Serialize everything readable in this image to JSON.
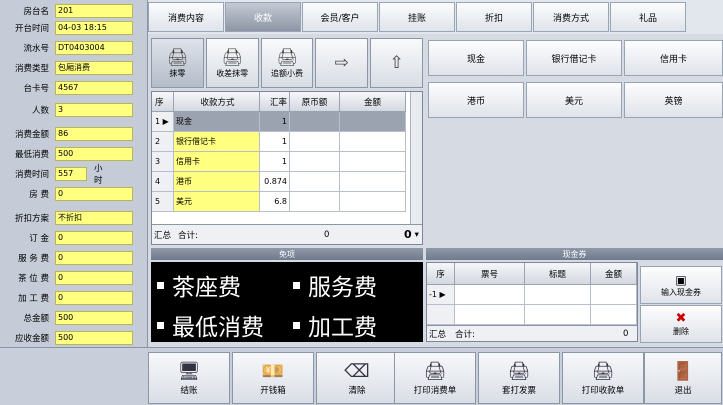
{
  "left_panel": {
    "fields": [
      {
        "label": "房台名",
        "value": "201"
      },
      {
        "label": "开台时间",
        "value": "04-03 18:15"
      },
      {
        "label": "流水号",
        "value": "DT0403004"
      },
      {
        "label": "消费类型",
        "value": "包厢消费"
      },
      {
        "label": "台卡号",
        "value": "4567"
      },
      {
        "label": "人数",
        "value": "3"
      },
      {
        "label": "消费金额",
        "value": "86"
      },
      {
        "label": "最低消费",
        "value": "500"
      },
      {
        "label": "消费时间",
        "value": "557"
      },
      {
        "label": "房 费",
        "value": "0"
      },
      {
        "label": "折扣方案",
        "value": "不折扣"
      },
      {
        "label": "订 金",
        "value": "0"
      },
      {
        "label": "服 务 费",
        "value": "0"
      },
      {
        "label": "茶 位 费",
        "value": "0"
      },
      {
        "label": "加 工 费",
        "value": "0"
      },
      {
        "label": "总金额",
        "value": "500"
      },
      {
        "label": "应收金额",
        "value": "500"
      }
    ],
    "time_unit": "小时"
  },
  "tabs": [
    "消费内容",
    "收款",
    "会员/客户",
    "挂账",
    "折扣",
    "消费方式",
    "礼品"
  ],
  "toolbar": {
    "buttons": [
      {
        "label": "抹零",
        "icon": "printer-icon"
      },
      {
        "label": "收差抹零",
        "icon": "printer-icon"
      },
      {
        "label": "追额小费",
        "icon": "printer-icon"
      },
      {
        "label": "",
        "icon": "arrow-right-icon"
      },
      {
        "label": "",
        "icon": "arrow-up-icon"
      }
    ]
  },
  "grid": {
    "headers": [
      "序",
      "收款方式",
      "汇率",
      "原币额",
      "金额"
    ],
    "rows": [
      {
        "no": "1",
        "method": "现金",
        "rate": "1",
        "orig": "",
        "amount": ""
      },
      {
        "no": "2",
        "method": "银行借记卡",
        "rate": "1",
        "orig": "",
        "amount": ""
      },
      {
        "no": "3",
        "method": "信用卡",
        "rate": "1",
        "orig": "",
        "amount": ""
      },
      {
        "no": "4",
        "method": "港币",
        "rate": "0.874",
        "orig": "",
        "amount": ""
      },
      {
        "no": "5",
        "method": "美元",
        "rate": "6.8",
        "orig": "",
        "amount": ""
      }
    ],
    "footer_label": "汇总",
    "total_label": "合计:",
    "total_orig": "0",
    "total_amount": "0"
  },
  "payment_buttons": [
    "现金",
    "银行借记卡",
    "信用卡",
    "港币",
    "美元",
    "英镑"
  ],
  "fees_panel": {
    "title": "免项",
    "items": [
      "茶座费",
      "服务费",
      "最低消费",
      "加工费"
    ]
  },
  "voucher": {
    "title": "现金券",
    "headers": [
      "序",
      "票号",
      "标题",
      "金额"
    ],
    "row_no": "-1",
    "footer_label": "汇总",
    "total_label": "合计:",
    "total_value": "0",
    "input_label": "输入现金券",
    "delete_label": "删除"
  },
  "bottom_buttons": [
    {
      "label": "结账",
      "icon": "monitor-icon"
    },
    {
      "label": "开钱箱",
      "icon": "cash-box-icon"
    },
    {
      "label": "清除",
      "icon": "eraser-icon"
    },
    {
      "label": "打印消费单",
      "icon": "printer-icon"
    },
    {
      "label": "套打发票",
      "icon": "printer-icon"
    },
    {
      "label": "打印收款单",
      "icon": "printer-icon"
    },
    {
      "label": "退出",
      "icon": "exit-door-icon"
    }
  ],
  "colors": {
    "field_bg": "#ffff80",
    "active_tab": "#8d96a5",
    "fee_bg": "#000000",
    "delete_icon": "#cc0000"
  }
}
